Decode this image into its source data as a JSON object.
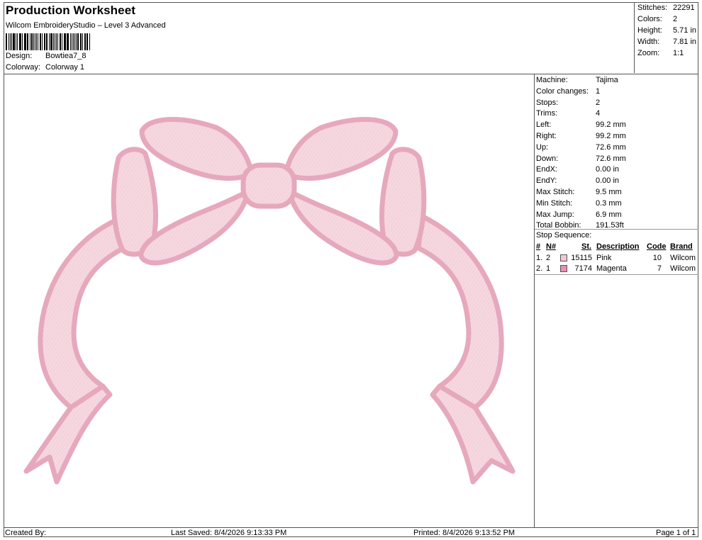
{
  "header": {
    "title": "Production Worksheet",
    "subtitle": "Wilcom EmbroideryStudio – Level 3 Advanced",
    "design_label": "Design:",
    "design_value": "Bowtiea7_8",
    "colorway_label": "Colorway:",
    "colorway_value": "Colorway 1"
  },
  "summary": {
    "stitches_label": "Stitches:",
    "stitches_value": "22291",
    "colors_label": "Colors:",
    "colors_value": "2",
    "height_label": "Height:",
    "height_value": "5.71 in",
    "width_label": "Width:",
    "width_value": "7.81 in",
    "zoom_label": "Zoom:",
    "zoom_value": "1:1"
  },
  "machine_info": [
    {
      "label": "Machine:",
      "value": "Tajima"
    },
    {
      "label": "Color changes:",
      "value": "1"
    },
    {
      "label": "Stops:",
      "value": "2"
    },
    {
      "label": "Trims:",
      "value": "4"
    },
    {
      "label": "Left:",
      "value": "99.2 mm"
    },
    {
      "label": "Right:",
      "value": "99.2 mm"
    },
    {
      "label": "Up:",
      "value": "72.6 mm"
    },
    {
      "label": "Down:",
      "value": "72.6 mm"
    },
    {
      "label": "EndX:",
      "value": "0.00 in"
    },
    {
      "label": "EndY:",
      "value": "0.00 in"
    },
    {
      "label": "Max Stitch:",
      "value": "9.5 mm"
    },
    {
      "label": "Min Stitch:",
      "value": "0.3 mm"
    },
    {
      "label": "Max Jump:",
      "value": "6.9 mm"
    },
    {
      "label": "Total Bobbin:",
      "value": "191.53ft"
    }
  ],
  "stop_sequence": {
    "title": "Stop Sequence:",
    "headers": {
      "num": "#",
      "n": "N#",
      "st": "St.",
      "desc": "Description",
      "code": "Code",
      "brand": "Brand"
    },
    "rows": [
      {
        "num": "1.",
        "n": "2",
        "color": "#f4c6d6",
        "st": "15115",
        "desc": "Pink",
        "code": "10",
        "brand": "Wilcom"
      },
      {
        "num": "2.",
        "n": "1",
        "color": "#e78fb3",
        "st": "7174",
        "desc": "Magenta",
        "code": "7",
        "brand": "Wilcom"
      }
    ]
  },
  "footer": {
    "created_by": "Created By:",
    "last_saved": "Last Saved: 8/4/2026 9:13:33 PM",
    "printed": "Printed: 8/4/2026 9:13:52 PM",
    "page": "Page 1 of 1"
  },
  "colors": {
    "ribbon_fill": "#f4d3dc",
    "ribbon_outline": "#e6a8bd",
    "ribbon_edge": "#c98aa2"
  }
}
